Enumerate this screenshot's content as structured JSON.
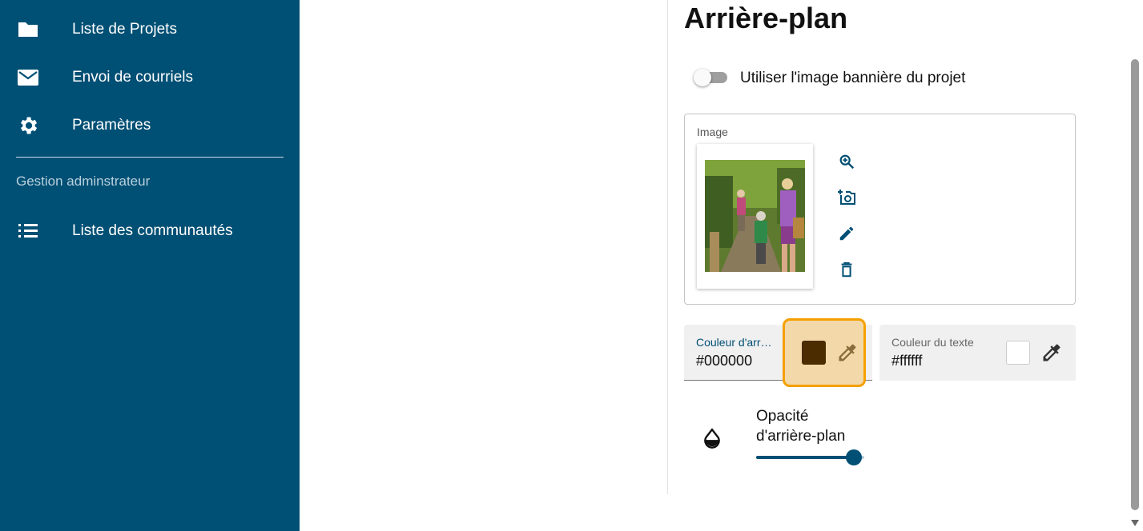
{
  "sidebar": {
    "items": [
      {
        "label": "Liste de Projets",
        "icon": "folder-icon"
      },
      {
        "label": "Envoi de courriels",
        "icon": "mail-icon"
      },
      {
        "label": "Paramètres",
        "icon": "gear-icon"
      }
    ],
    "section_title": "Gestion adminstrateur",
    "admin_items": [
      {
        "label": "Liste des communautés",
        "icon": "list-icon"
      }
    ]
  },
  "main": {
    "title": "Arrière-plan",
    "banner_toggle": {
      "label": "Utiliser l'image bannière du projet",
      "checked": false
    },
    "image_field": {
      "legend": "Image"
    },
    "background_color": {
      "label": "Couleur d'arrière-plan",
      "value": "#000000",
      "swatch": "#4a2c00"
    },
    "text_color": {
      "label": "Couleur du texte",
      "value": "#ffffff"
    },
    "opacity": {
      "label": "Opacité d'arrière-plan",
      "value_fraction": 0.9
    }
  },
  "colors": {
    "sidebar_bg": "#004f74",
    "accent": "#004f74",
    "highlight_border": "#f5a000"
  }
}
